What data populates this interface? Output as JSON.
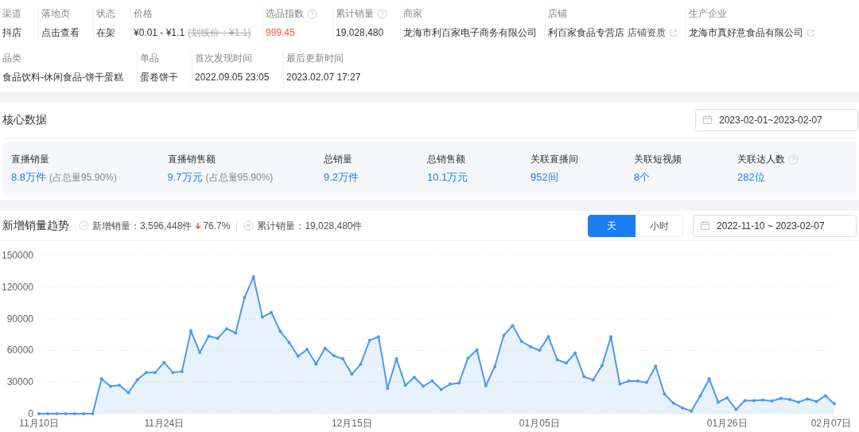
{
  "info_rows": [
    [
      {
        "label": "渠道",
        "value": "抖店"
      },
      {
        "label": "落地页",
        "value": "点击查看"
      },
      {
        "label": "状态",
        "value": "在架"
      },
      {
        "label": "价格",
        "value": "¥0.01 - ¥1.1",
        "struck": "(划线价：¥1.1)"
      },
      {
        "label": "选品指数",
        "value": "999.45",
        "help": true,
        "highlight": true
      },
      {
        "label": "累计销量",
        "value": "19,028,480",
        "help": true
      },
      {
        "label": "商家",
        "value": "龙海市利百家电子商务有限公司"
      },
      {
        "label": "店铺",
        "value": "利百家食品专营店",
        "link": "店铺资质",
        "external": true
      },
      {
        "label": "生产企业",
        "value": "龙海市真好意食品有限公司",
        "external": true
      }
    ],
    [
      {
        "label": "品类",
        "value": "食品饮料-休闲食品-饼干蛋糕"
      },
      {
        "label": "单品",
        "value": "蛋卷饼干"
      },
      {
        "label": "首次发现时间",
        "value": "2022.09.05 23:05"
      },
      {
        "label": "最后更新时间",
        "value": "2023.02.07 17:27"
      }
    ]
  ],
  "core": {
    "title": "核心数据",
    "date_range": "2023-02-01~2023-02-07",
    "metrics": [
      {
        "label": "直播销量",
        "value": "8.8",
        "unit": "万件",
        "note": "(占总量95.90%)"
      },
      {
        "label": "直播销售额",
        "value": "9.7",
        "unit": "万元",
        "note": "(占总量95.90%)"
      },
      {
        "label": "总销量",
        "value": "9.2",
        "unit": "万件"
      },
      {
        "label": "总销售额",
        "value": "10.1",
        "unit": "万元"
      },
      {
        "label": "关联直播间",
        "value": "952",
        "unit": "间"
      },
      {
        "label": "关联短视频",
        "value": "8",
        "unit": "个"
      },
      {
        "label": "关联达人数",
        "value": "282",
        "unit": "位",
        "help": true
      }
    ]
  },
  "trend": {
    "title": "新增销量趋势",
    "new_label": "新增销量：",
    "new_value": "3,596,448件",
    "change": "76.7%",
    "x_axis_labels": [
      "11月10日",
      "11月24日",
      "12月15日",
      "01月05日",
      "01月26日",
      "02月07日"
    ],
    "total_label": "累计销量：",
    "total_value": "19,028,480件",
    "tabs": [
      {
        "label": "天",
        "selected": true
      },
      {
        "label": "小时",
        "selected": false
      }
    ],
    "date_range": "2022-11-10 ~ 2023-02-07",
    "chart_data": {
      "type": "area",
      "ylim": [
        0,
        150000
      ],
      "yticks": [
        0,
        30000,
        60000,
        90000,
        120000,
        150000
      ],
      "grid": true,
      "series": [
        {
          "color": "#4a9af0",
          "values": [
            0,
            0,
            0,
            0,
            0,
            0,
            0,
            33000,
            26000,
            27000,
            20000,
            32000,
            39000,
            39000,
            48500,
            39000,
            40000,
            78500,
            58000,
            73500,
            71500,
            80500,
            76500,
            110000,
            129500,
            91500,
            96000,
            78000,
            67500,
            54500,
            61000,
            47000,
            62000,
            55000,
            52000,
            37500,
            47000,
            69500,
            73000,
            24000,
            52000,
            27000,
            34500,
            26000,
            31000,
            23000,
            28000,
            29000,
            52500,
            60500,
            26500,
            44500,
            74000,
            83500,
            68500,
            63500,
            60000,
            73000,
            51000,
            48000,
            57500,
            35000,
            32000,
            45500,
            73000,
            28000,
            31000,
            31000,
            29500,
            45000,
            18500,
            10000,
            5500,
            2500,
            17000,
            33000,
            11000,
            15000,
            4000,
            12500,
            12500,
            13000,
            12000,
            14500,
            13500,
            11000,
            14000,
            11500,
            17000,
            9500
          ]
        }
      ]
    }
  }
}
